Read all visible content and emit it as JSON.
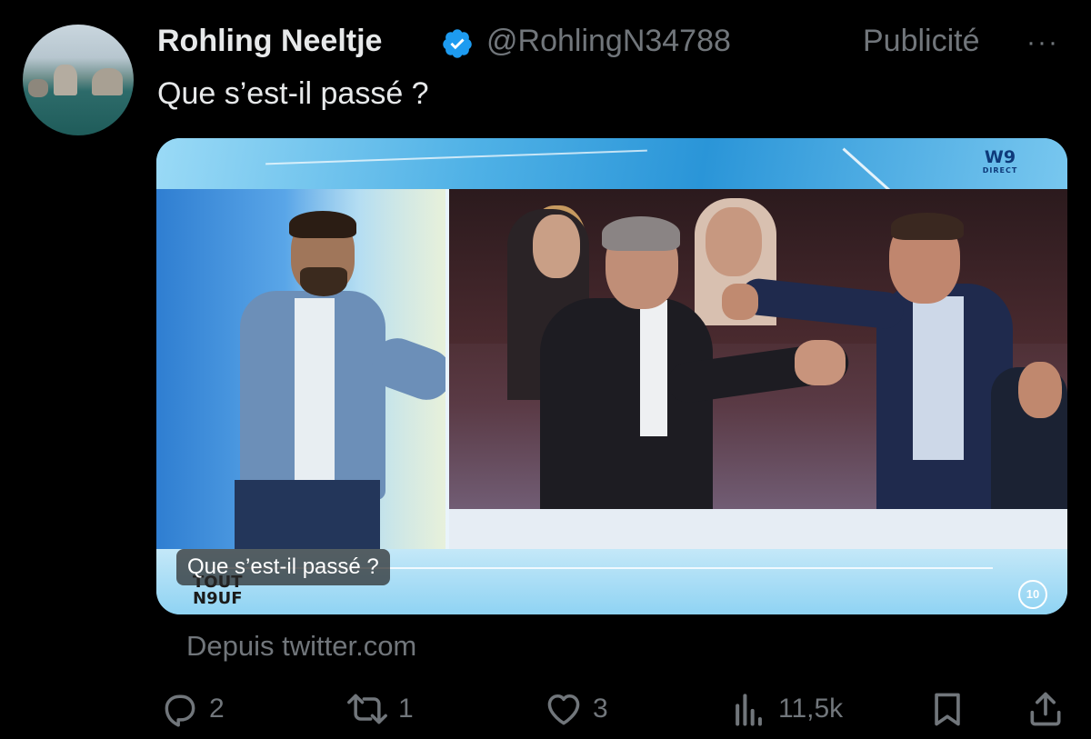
{
  "author": {
    "name": "Rohling Neeltje",
    "handle": "@RohlingN34788",
    "verified_icon": "verified-badge-icon",
    "label": "Publicité",
    "more": "···"
  },
  "tweet": {
    "text": "Que s’est-il passé ?"
  },
  "media": {
    "channel_logo": "W9",
    "channel_sub": "DIRECT",
    "show_logo_line1": "TOUT",
    "show_logo_line2": "N9UF",
    "badge": "10",
    "caption": "Que s’est-il passé ?"
  },
  "source": "Depuis twitter.com",
  "actions": {
    "replies": "2",
    "retweets": "1",
    "likes": "3",
    "views": "11,5k"
  },
  "colors": {
    "background": "#000000",
    "primary_text": "#e7e9ea",
    "secondary_text": "#71767b",
    "verified": "#1d9bf0"
  }
}
